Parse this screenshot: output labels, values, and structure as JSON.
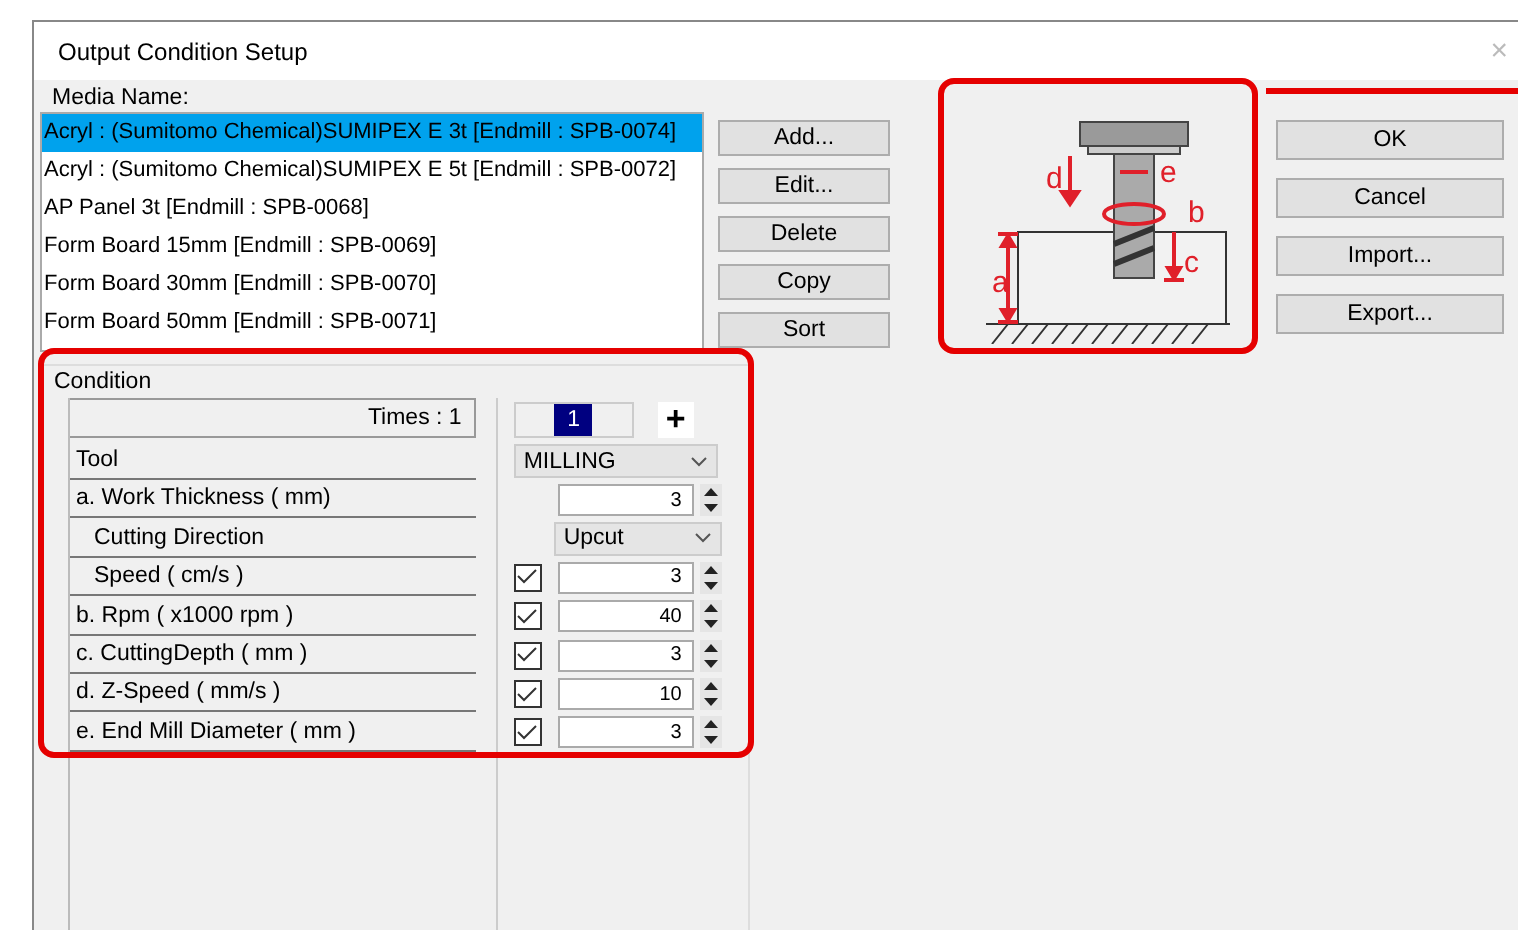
{
  "window": {
    "title": "Output Condition Setup",
    "close": "×"
  },
  "media": {
    "label": "Media Name:",
    "items": [
      {
        "text": "Acryl : (Sumitomo Chemical)SUMIPEX E 3t [Endmill : SPB-0074]",
        "selected": true
      },
      {
        "text": "Acryl : (Sumitomo Chemical)SUMIPEX E 5t [Endmill : SPB-0072]",
        "selected": false
      },
      {
        "text": "AP Panel 3t [Endmill : SPB-0068]",
        "selected": false
      },
      {
        "text": "Form Board 15mm [Endmill : SPB-0069]",
        "selected": false
      },
      {
        "text": "Form Board 30mm [Endmill : SPB-0070]",
        "selected": false
      },
      {
        "text": "Form Board 50mm [Endmill : SPB-0071]",
        "selected": false
      }
    ]
  },
  "media_buttons": [
    "Add...",
    "Edit...",
    "Delete",
    "Copy",
    "Sort"
  ],
  "diagram": {
    "labels": [
      "a",
      "b",
      "c",
      "d",
      "e"
    ]
  },
  "dialog_buttons": [
    "OK",
    "Cancel",
    "Import...",
    "Export..."
  ],
  "condition": {
    "title": "Condition",
    "times": "Times : 1",
    "tab": {
      "label": "1",
      "selected": true
    },
    "add": "+",
    "rows": [
      {
        "label": "Tool",
        "kind": "dropdown",
        "value": "MILLING"
      },
      {
        "label": "a. Work Thickness ( mm)",
        "kind": "spin",
        "value": "3",
        "children": [
          {
            "label": "Cutting Direction",
            "kind": "dropdown",
            "value": "Upcut"
          },
          {
            "label": "Speed ( cm/s )",
            "kind": "spin",
            "value": "3",
            "checked": true
          }
        ]
      },
      {
        "label": "b. Rpm ( x1000  rpm )",
        "kind": "spin",
        "value": "40",
        "checked": true
      },
      {
        "label": "c. CuttingDepth ( mm )",
        "kind": "spin",
        "value": "3",
        "checked": true
      },
      {
        "label": "d. Z-Speed ( mm/s )",
        "kind": "spin",
        "value": "10",
        "checked": true
      },
      {
        "label": "e. End Mill Diameter ( mm )",
        "kind": "spin",
        "value": "3",
        "checked": true
      }
    ]
  }
}
